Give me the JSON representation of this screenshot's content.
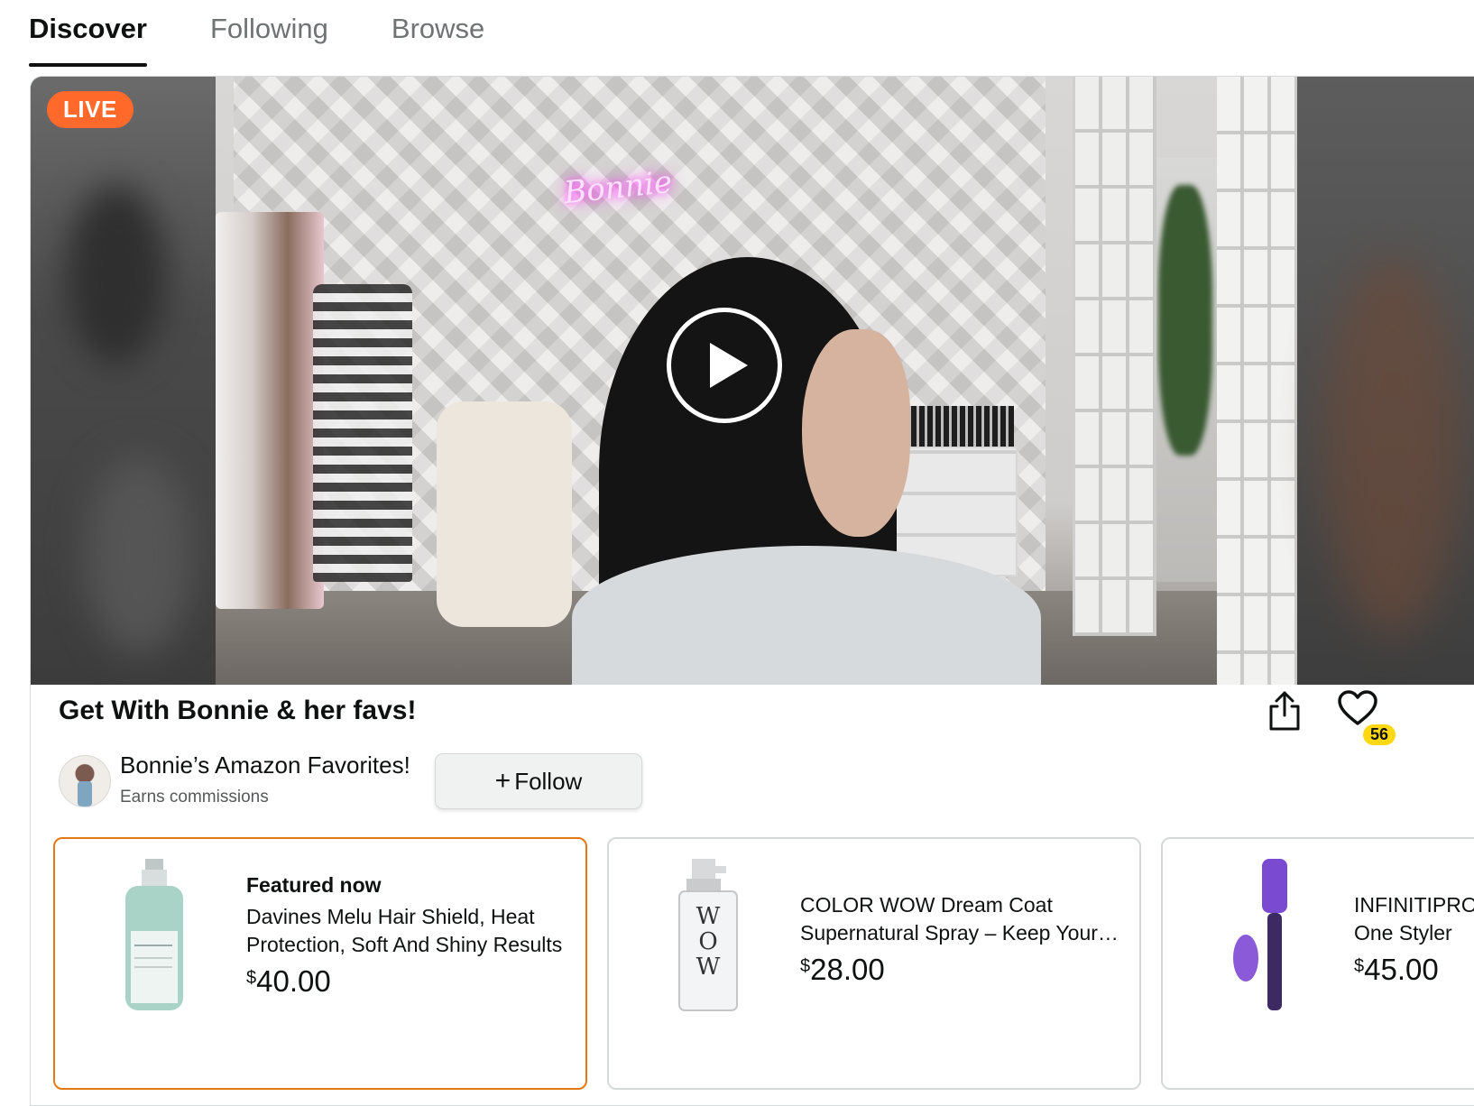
{
  "tabs": [
    {
      "label": "Discover",
      "active": true
    },
    {
      "label": "Following",
      "active": false
    },
    {
      "label": "Browse",
      "active": false
    }
  ],
  "video": {
    "live_label": "LIVE",
    "neon_sign": "Bonnie",
    "play_icon": "play-icon"
  },
  "stream": {
    "title": "Get With Bonnie & her favs!",
    "likes_count": "56",
    "share_icon": "share-icon",
    "heart_icon": "heart-icon"
  },
  "creator": {
    "name": "Bonnie’s Amazon Favorites!",
    "subtitle": "Earns commissions",
    "follow_label": "Follow"
  },
  "products": [
    {
      "featured_label": "Featured now",
      "name": "Davines Melu Hair Shield, Heat Protection, Soft And Shiny Results",
      "currency": "$",
      "price": "40.00"
    },
    {
      "featured_label": "",
      "name": "COLOR WOW Dream Coat Supernatural Spray – Keep Your Hair Frizz-Free",
      "currency": "$",
      "price": "28.00"
    },
    {
      "featured_label": "",
      "name": "INFINITIPRO BY CONAIR Dr. All-in-One Styler",
      "currency": "$",
      "price": "45.00"
    }
  ],
  "colors": {
    "live_badge": "#ff6a2b",
    "featured_border": "#e47911",
    "likes_badge": "#ffd814"
  }
}
